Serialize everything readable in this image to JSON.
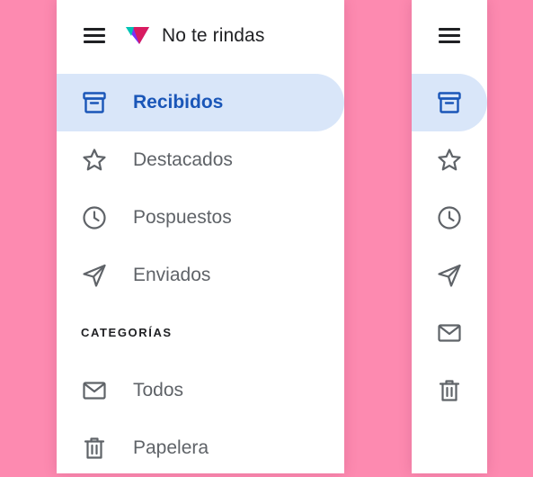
{
  "app": {
    "name": "No te rindas"
  },
  "colors": {
    "background": "#fd8ab0",
    "active_bg": "#d9e6f9",
    "active_fg": "#1a56b8",
    "icon": "#5f6368"
  },
  "nav": {
    "items": [
      {
        "label": "Recibidos",
        "icon": "inbox-icon",
        "active": true
      },
      {
        "label": "Destacados",
        "icon": "star-icon",
        "active": false
      },
      {
        "label": "Pospuestos",
        "icon": "clock-icon",
        "active": false
      },
      {
        "label": "Enviados",
        "icon": "send-icon",
        "active": false
      }
    ],
    "section_title": "CATEGORÍAS",
    "category_items": [
      {
        "label": "Todos",
        "icon": "mail-icon"
      },
      {
        "label": "Papelera",
        "icon": "trash-icon"
      }
    ]
  }
}
